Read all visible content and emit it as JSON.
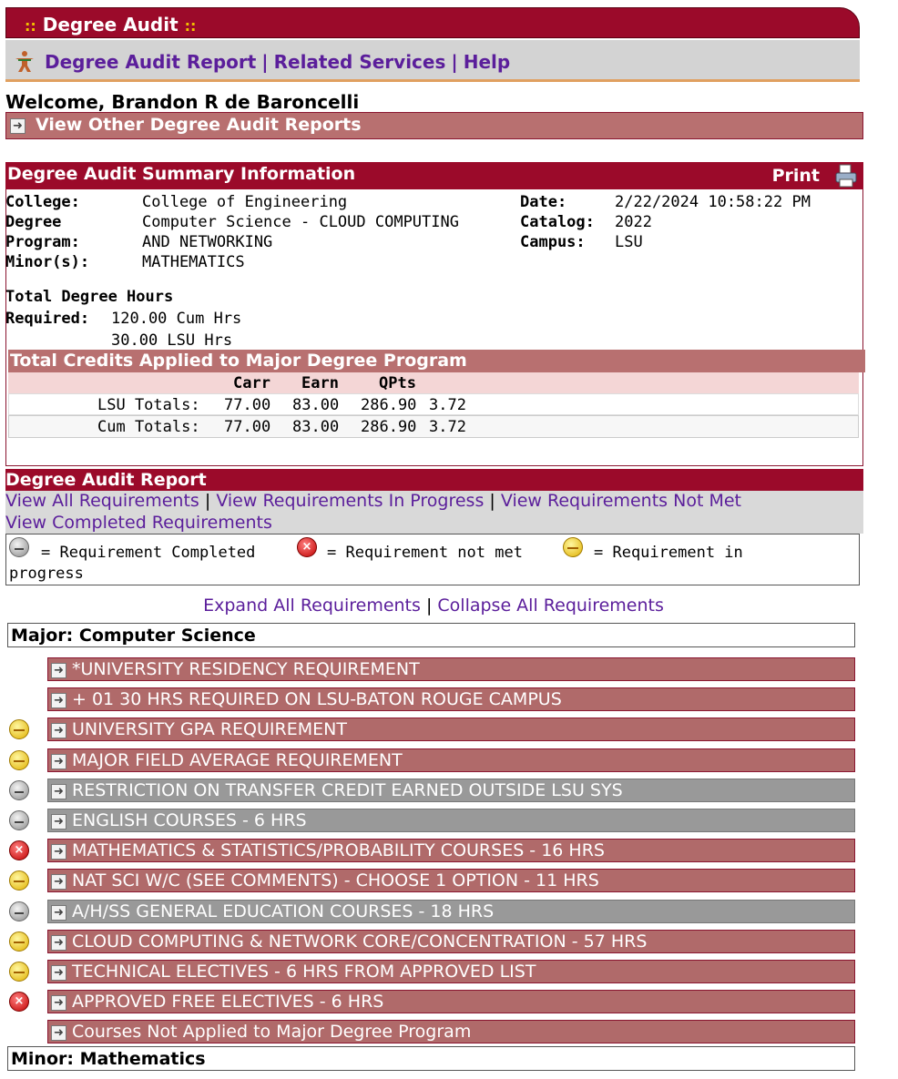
{
  "header": {
    "title": "Degree Audit"
  },
  "nav": {
    "items": [
      "Degree Audit Report",
      "Related Services",
      "Help"
    ],
    "separator": "|"
  },
  "welcome": "Welcome, Brandon R de Baroncelli",
  "other_reports": "View Other Degree Audit Reports",
  "summary": {
    "title": "Degree Audit Summary Information",
    "print": "Print",
    "college_label": "College:",
    "college": "College of Engineering",
    "degree_label": "Degree",
    "degree": "Computer Science - CLOUD COMPUTING",
    "program_label": "Program:",
    "program": "AND NETWORKING",
    "minor_label": "Minor(s):",
    "minor": "MATHEMATICS",
    "date_label": "Date:",
    "date": "2/22/2024 10:58:22 PM",
    "catalog_label": "Catalog:",
    "catalog": "2022",
    "campus_label": "Campus:",
    "campus": "LSU",
    "hours_label_1": "Total Degree Hours",
    "hours_label_2": "Required:",
    "hours_cum": "120.00 Cum Hrs",
    "hours_lsu": "30.00 LSU Hrs"
  },
  "credits": {
    "title": "Total Credits Applied to Major Degree Program",
    "columns": [
      "Carr",
      "Earn",
      "QPts"
    ],
    "rows": [
      {
        "label": "LSU Totals:",
        "carr": "77.00",
        "earn": "83.00",
        "qpts": "286.90",
        "gpa": "3.72"
      },
      {
        "label": "Cum Totals:",
        "carr": "77.00",
        "earn": "83.00",
        "qpts": "286.90",
        "gpa": "3.72"
      }
    ]
  },
  "report": {
    "title": "Degree Audit Report",
    "filters": [
      "View All Requirements",
      "View Requirements In Progress",
      "View Requirements Not Met",
      "View Completed Requirements"
    ],
    "legend": {
      "completed": "= Requirement Completed",
      "not_met": "= Requirement not met",
      "in_progress_1": "= Requirement in",
      "in_progress_2": "progress"
    },
    "expand": "Expand All Requirements",
    "collapse": "Collapse All Requirements",
    "major": "Major: Computer Science",
    "minor": "Minor: Mathematics",
    "requirements": [
      {
        "label": " *UNIVERSITY RESIDENCY REQUIREMENT",
        "status": "none"
      },
      {
        "label": " + 01  30 HRS REQUIRED ON LSU-BATON ROUGE CAMPUS",
        "status": "none"
      },
      {
        "label": "UNIVERSITY GPA REQUIREMENT",
        "status": "in-progress"
      },
      {
        "label": "MAJOR FIELD AVERAGE REQUIREMENT",
        "status": "in-progress"
      },
      {
        "label": "RESTRICTION ON TRANSFER CREDIT EARNED OUTSIDE LSU SYS",
        "status": "completed"
      },
      {
        "label": "ENGLISH COURSES - 6 HRS",
        "status": "completed"
      },
      {
        "label": "MATHEMATICS & STATISTICS/PROBABILITY COURSES - 16 HRS",
        "status": "not-met"
      },
      {
        "label": "NAT SCI W/C (SEE COMMENTS) - CHOOSE 1 OPTION - 11 HRS",
        "status": "in-progress"
      },
      {
        "label": "A/H/SS GENERAL EDUCATION COURSES - 18 HRS",
        "status": "completed"
      },
      {
        "label": "CLOUD COMPUTING & NETWORK CORE/CONCENTRATION - 57 HRS",
        "status": "in-progress"
      },
      {
        "label": "TECHNICAL ELECTIVES - 6 HRS FROM APPROVED LIST",
        "status": "in-progress"
      },
      {
        "label": "APPROVED FREE ELECTIVES - 6 HRS",
        "status": "not-met"
      },
      {
        "label": " Courses Not Applied to Major Degree Program",
        "status": "none"
      }
    ]
  }
}
